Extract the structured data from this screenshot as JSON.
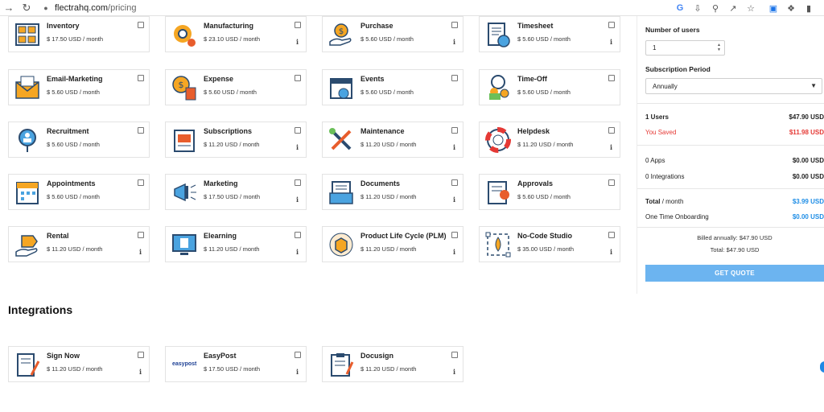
{
  "browser": {
    "url_host": "flectrahq.com",
    "url_path": "/pricing",
    "back_icon": "back-arrow-icon",
    "reload_icon": "reload-icon"
  },
  "modules": [
    {
      "name": "Inventory",
      "price": "$ 17.50 USD / month",
      "icon": "inventory-icon",
      "info": false
    },
    {
      "name": "Manufacturing",
      "price": "$ 23.10 USD / month",
      "icon": "manufacturing-icon",
      "info": true
    },
    {
      "name": "Purchase",
      "price": "$ 5.60 USD / month",
      "icon": "purchase-icon",
      "info": true
    },
    {
      "name": "Timesheet",
      "price": "$ 5.60 USD / month",
      "icon": "timesheet-icon",
      "info": true
    },
    {
      "name": "Email-Marketing",
      "price": "$ 5.60 USD / month",
      "icon": "email-marketing-icon",
      "info": false
    },
    {
      "name": "Expense",
      "price": "$ 5.60 USD / month",
      "icon": "expense-icon",
      "info": false
    },
    {
      "name": "Events",
      "price": "$ 5.60 USD / month",
      "icon": "events-icon",
      "info": false
    },
    {
      "name": "Time-Off",
      "price": "$ 5.60 USD / month",
      "icon": "time-off-icon",
      "info": false
    },
    {
      "name": "Recruitment",
      "price": "$ 5.60 USD / month",
      "icon": "recruitment-icon",
      "info": false
    },
    {
      "name": "Subscriptions",
      "price": "$ 11.20 USD / month",
      "icon": "subscriptions-icon",
      "info": true
    },
    {
      "name": "Maintenance",
      "price": "$ 11.20 USD / month",
      "icon": "maintenance-icon",
      "info": true
    },
    {
      "name": "Helpdesk",
      "price": "$ 11.20 USD / month",
      "icon": "helpdesk-icon",
      "info": true
    },
    {
      "name": "Appointments",
      "price": "$ 5.60 USD / month",
      "icon": "appointments-icon",
      "info": false
    },
    {
      "name": "Marketing",
      "price": "$ 17.50 USD / month",
      "icon": "marketing-icon",
      "info": true
    },
    {
      "name": "Documents",
      "price": "$ 11.20 USD / month",
      "icon": "documents-icon",
      "info": true
    },
    {
      "name": "Approvals",
      "price": "$ 5.60 USD / month",
      "icon": "approvals-icon",
      "info": false
    },
    {
      "name": "Rental",
      "price": "$ 11.20 USD / month",
      "icon": "rental-icon",
      "info": true
    },
    {
      "name": "Elearning",
      "price": "$ 11.20 USD / month",
      "icon": "elearning-icon",
      "info": true
    },
    {
      "name": "Product Life Cycle (PLM)",
      "price": "$ 11.20 USD / month",
      "icon": "plm-icon",
      "info": true
    },
    {
      "name": "No-Code Studio",
      "price": "$ 35.00 USD / month",
      "icon": "studio-icon",
      "info": true
    }
  ],
  "integrations_title": "Integrations",
  "integrations": [
    {
      "name": "Sign Now",
      "price": "$ 11.20 USD / month",
      "icon": "sign-now-icon",
      "info": true,
      "logo_text": ""
    },
    {
      "name": "EasyPost",
      "price": "$ 17.50 USD / month",
      "icon": "easypost-logo-icon",
      "info": true,
      "logo_text": "easypost"
    },
    {
      "name": "Docusign",
      "price": "$ 11.20 USD / month",
      "icon": "docusign-icon",
      "info": true,
      "logo_text": ""
    }
  ],
  "sidebar": {
    "users_label": "Number of users",
    "users_value": "1",
    "period_label": "Subscription Period",
    "period_value": "Annually",
    "users_line_label": "1 Users",
    "users_line_value": "$47.90 USD",
    "saved_label": "You Saved",
    "saved_value": "$11.98 USD",
    "apps_label": "0 Apps",
    "apps_value": "$0.00 USD",
    "integrations_label": "0 Integrations",
    "integrations_value": "$0.00 USD",
    "total_label_bold": "Total",
    "total_label_rest": " / month",
    "total_value": "$3.99 USD",
    "onboarding_label": "One Time Onboarding",
    "onboarding_value": "$0.00 USD",
    "billed_annually": "Billed annually: $47.90 USD",
    "total_line": "Total: $47.90 USD",
    "quote_button": "GET QUOTE"
  },
  "colors": {
    "accent_blue": "#6cb4f0",
    "link_blue": "#1f8ee6",
    "saved_red": "#e53935",
    "icon_orange": "#f5a623",
    "icon_navy": "#2b4b6f"
  }
}
